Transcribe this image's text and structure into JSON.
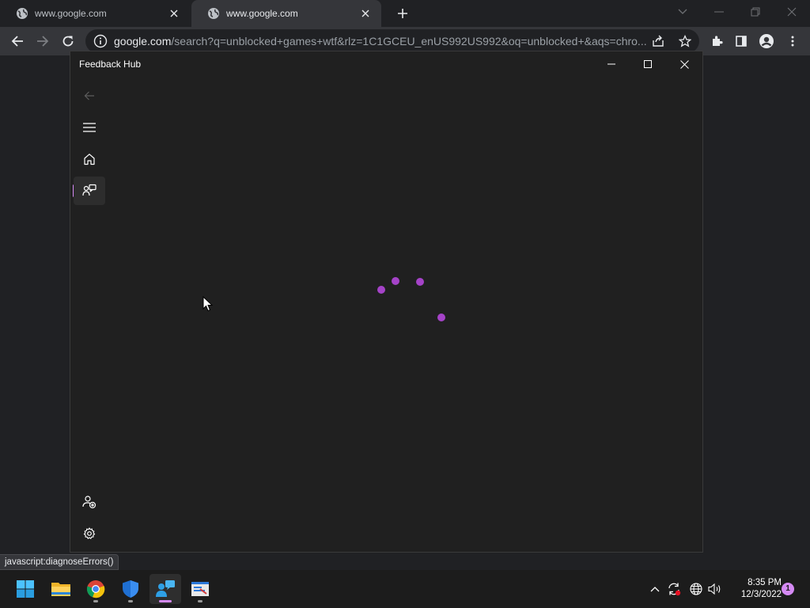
{
  "browser": {
    "tabs": [
      {
        "title": "www.google.com",
        "active": false
      },
      {
        "title": "www.google.com",
        "active": true
      }
    ],
    "url_host": "google.com",
    "url_path": "/search?q=unblocked+games+wtf&rlz=1C1GCEU_enUS992US992&oq=unblocked+&aqs=chro..."
  },
  "feedback_hub": {
    "title": "Feedback Hub",
    "nav": [
      {
        "id": "back",
        "icon": "back-arrow-icon",
        "enabled": false
      },
      {
        "id": "menu",
        "icon": "hamburger-icon"
      },
      {
        "id": "home",
        "icon": "home-icon"
      },
      {
        "id": "feedback",
        "icon": "feedback-icon",
        "selected": true
      },
      {
        "id": "account",
        "icon": "add-account-icon"
      },
      {
        "id": "settings",
        "icon": "gear-icon"
      }
    ],
    "loading_color": "#a543c8",
    "accent": "#d58af5"
  },
  "status_bar": {
    "text": "javascript:diagnoseErrors()"
  },
  "taskbar": {
    "apps": [
      "start",
      "file-explorer",
      "chrome",
      "windows-security",
      "feedback-hub",
      "screen-snip"
    ],
    "active_app": "feedback-hub",
    "time": "8:35 PM",
    "date": "12/3/2022",
    "notification_count": "1"
  }
}
